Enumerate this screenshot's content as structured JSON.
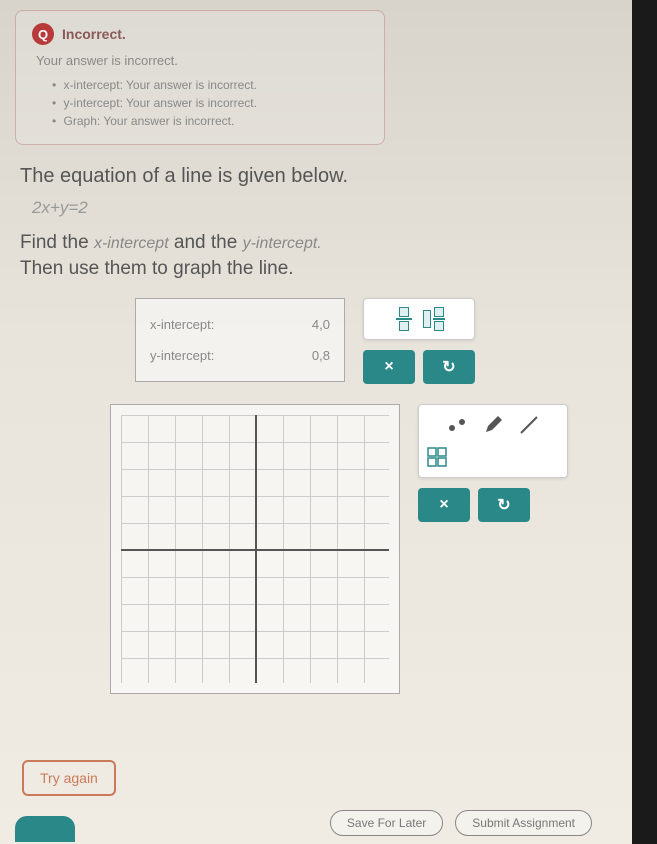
{
  "feedback": {
    "title": "Incorrect.",
    "subtitle": "Your answer is incorrect.",
    "items": [
      "x-intercept: Your answer is incorrect.",
      "y-intercept: Your answer is incorrect.",
      "Graph: Your answer is incorrect."
    ]
  },
  "question": {
    "line1": "The equation of a line is given below.",
    "equation": "2x+y=2",
    "line2_a": "Find the ",
    "line2_term1": "x-intercept",
    "line2_b": " and the ",
    "line2_term2": "y-intercept.",
    "line3": "Then use them to graph the line."
  },
  "intercepts": {
    "x_label": "x-intercept:",
    "x_value": "4,0",
    "y_label": "y-intercept:",
    "y_value": "0,8"
  },
  "tools": {
    "x_btn": "×",
    "redo_btn": "↻"
  },
  "graph_tools": {
    "x_btn": "×",
    "redo_btn": "↻"
  },
  "buttons": {
    "try_again": "Try again",
    "save": "Save For Later",
    "submit": "Submit Assignment"
  },
  "chart_data": {
    "type": "line",
    "title": "",
    "xlabel": "",
    "ylabel": "",
    "xlim": [
      -5,
      5
    ],
    "ylim": [
      -5,
      5
    ],
    "grid": true,
    "series": []
  }
}
